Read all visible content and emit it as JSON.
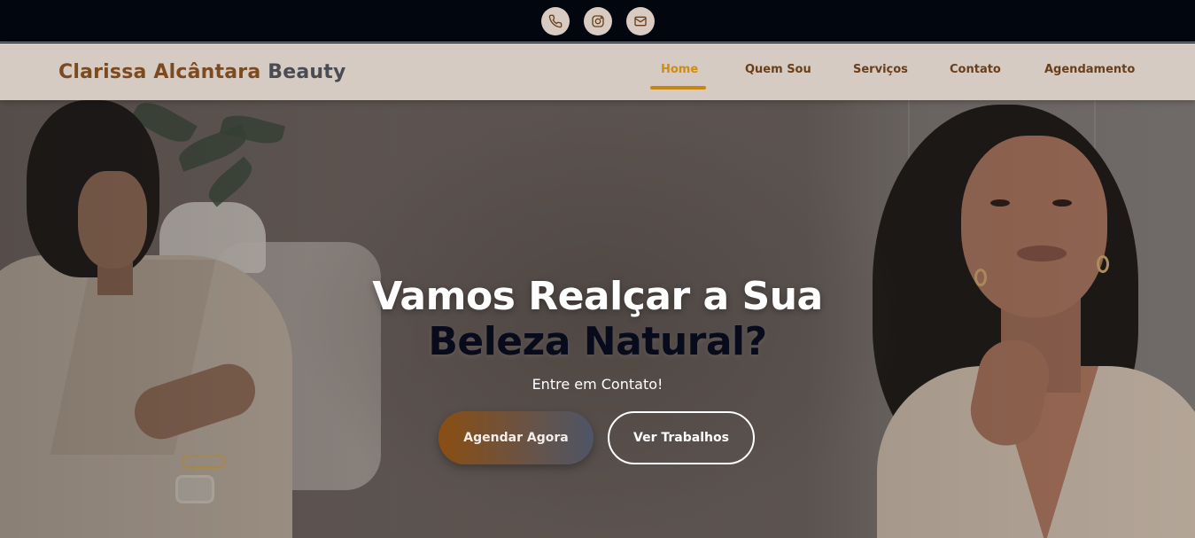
{
  "topbar": {
    "icons": [
      "phone-icon",
      "instagram-icon",
      "mail-icon"
    ]
  },
  "brand": {
    "part1": "Clarissa Alcântara",
    "part2": "Beauty"
  },
  "nav": {
    "items": [
      {
        "label": "Home",
        "active": true
      },
      {
        "label": "Quem Sou",
        "active": false
      },
      {
        "label": "Serviços",
        "active": false
      },
      {
        "label": "Contato",
        "active": false
      },
      {
        "label": "Agendamento",
        "active": false
      }
    ]
  },
  "hero": {
    "title_line1": "Vamos Realçar a Sua",
    "title_line2": "Beleza Natural?",
    "subtitle": "Entre em Contato!",
    "primary_button": "Agendar Agora",
    "secondary_button": "Ver Trabalhos"
  },
  "colors": {
    "topbar_bg": "#02060f",
    "navbar_bg": "#d5cbc3",
    "brand_primary": "#7b4a1e",
    "brand_secondary": "#4b4b52",
    "nav_active": "#d18b12",
    "nav_text": "#6b3e1a",
    "title_dark": "#070b1c"
  }
}
